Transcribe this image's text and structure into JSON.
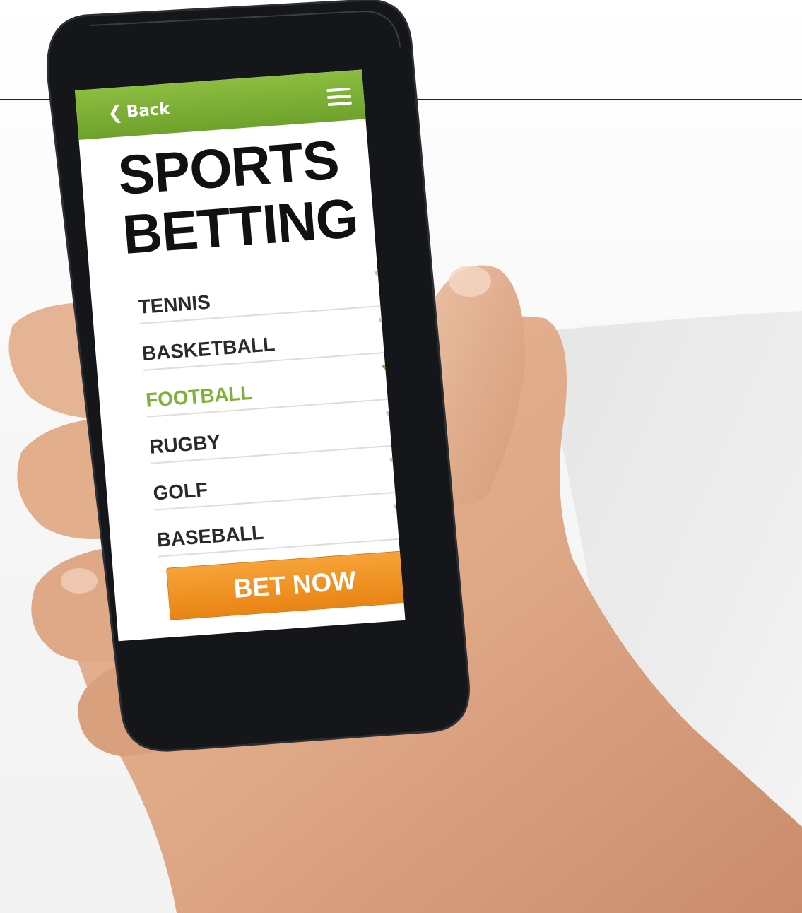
{
  "header": {
    "back_label": "Back"
  },
  "title": {
    "line1": "SPORTS",
    "line2": "BETTING"
  },
  "sports": [
    {
      "label": "TENNIS",
      "selected": false
    },
    {
      "label": "BASKETBALL",
      "selected": false
    },
    {
      "label": "FOOTBALL",
      "selected": true
    },
    {
      "label": "RUGBY",
      "selected": false
    },
    {
      "label": "GOLF",
      "selected": false
    },
    {
      "label": "BASEBALL",
      "selected": false
    }
  ],
  "bet_button": {
    "label": "BET NOW"
  },
  "colors": {
    "header_green": "#7fb236",
    "selected_green": "#7ab233",
    "check_gray": "#c4c4c4",
    "button_orange": "#f09428",
    "phone_body": "#141619",
    "background": "#f5f5f5"
  },
  "icons": {
    "back": "chevron-left-icon",
    "menu": "hamburger-menu-icon",
    "check": "check-icon"
  }
}
